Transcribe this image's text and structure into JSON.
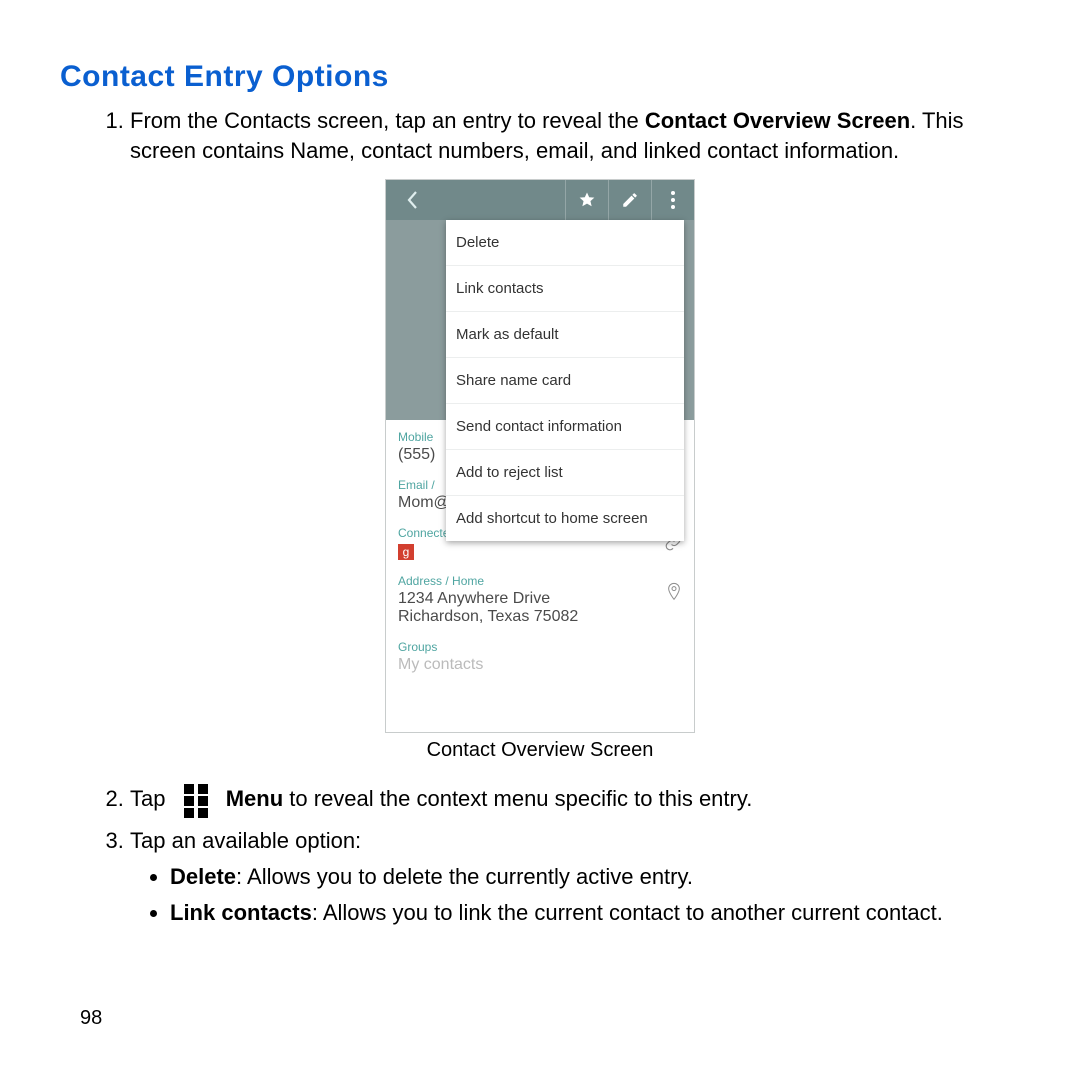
{
  "heading": "Contact Entry Options",
  "step1": {
    "pre": "From the Contacts screen, tap an entry to reveal the ",
    "bold": "Contact Overview Screen",
    "post": ". This screen contains Name, contact numbers, email, and linked contact information."
  },
  "caption": "Contact Overview Screen",
  "menu_items": [
    "Delete",
    "Link contacts",
    "Mark as default",
    "Share name card",
    "Send contact information",
    "Add to reject list",
    "Add shortcut to home screen"
  ],
  "phone": {
    "mobile_label": "Mobile",
    "mobile_value": "(555)",
    "email_label": "Email /",
    "email_value": "Mom@gmail.com",
    "connected_via_label": "Connected via",
    "g_badge": "g",
    "address_label": "Address / Home",
    "address_line1": "1234 Anywhere Drive",
    "address_line2": "Richardson, Texas 75082",
    "groups_label": "Groups",
    "groups_value": "My contacts"
  },
  "step2": {
    "pre": "Tap ",
    "bold": "Menu",
    "post": " to reveal the context menu specific to this entry."
  },
  "step3": "Tap an available option:",
  "bullets": {
    "delete_bold": "Delete",
    "delete_rest": ": Allows you to delete the currently active entry.",
    "link_bold": "Link contacts",
    "link_rest": ": Allows you to link the current contact to another current contact."
  },
  "page_number": "98"
}
